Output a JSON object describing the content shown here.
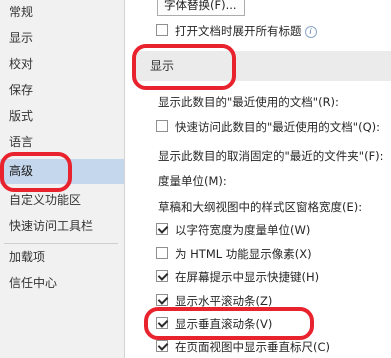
{
  "nav": {
    "items": [
      {
        "label": "常规"
      },
      {
        "label": "显示"
      },
      {
        "label": "校对"
      },
      {
        "label": "保存"
      },
      {
        "label": "版式"
      },
      {
        "label": "语言"
      },
      {
        "label": "高级",
        "selected": true
      },
      {
        "label": "自定义功能区"
      },
      {
        "label": "快速访问工具栏"
      },
      {
        "label": "加载项"
      },
      {
        "label": "信任中心"
      }
    ]
  },
  "main": {
    "font_substitution_button": "字体替换(F)...",
    "expand_headings_label": "打开文档时展开所有标题",
    "display_section_title": "显示",
    "recent_docs_label": "显示此数目的\"最近使用的文档\"(R):",
    "quick_access_recent_label": "快速访问此数目的\"最近使用的文档\"(Q):",
    "unpinned_folders_label": "显示此数目的取消固定的\"最近的文件夹\"(F):",
    "measurement_units_label": "度量单位(M):",
    "style_area_width_label": "草稿和大纲视图中的样式区窗格宽度(E):",
    "checkboxes": [
      {
        "label": "以字符宽度为度量单位(W)",
        "checked": true
      },
      {
        "label": "为 HTML 功能显示像素(X)",
        "checked": false
      },
      {
        "label": "在屏幕提示中显示快捷键(H)",
        "checked": true
      },
      {
        "label": "显示水平滚动条(Z)",
        "checked": true
      },
      {
        "label": "显示垂直滚动条(V)",
        "checked": true
      },
      {
        "label": "在页面视图中显示垂直标尺(C)",
        "checked": true
      }
    ]
  },
  "colors": {
    "annotation": "#e8232e",
    "selected_nav": "#c5d7ec"
  }
}
